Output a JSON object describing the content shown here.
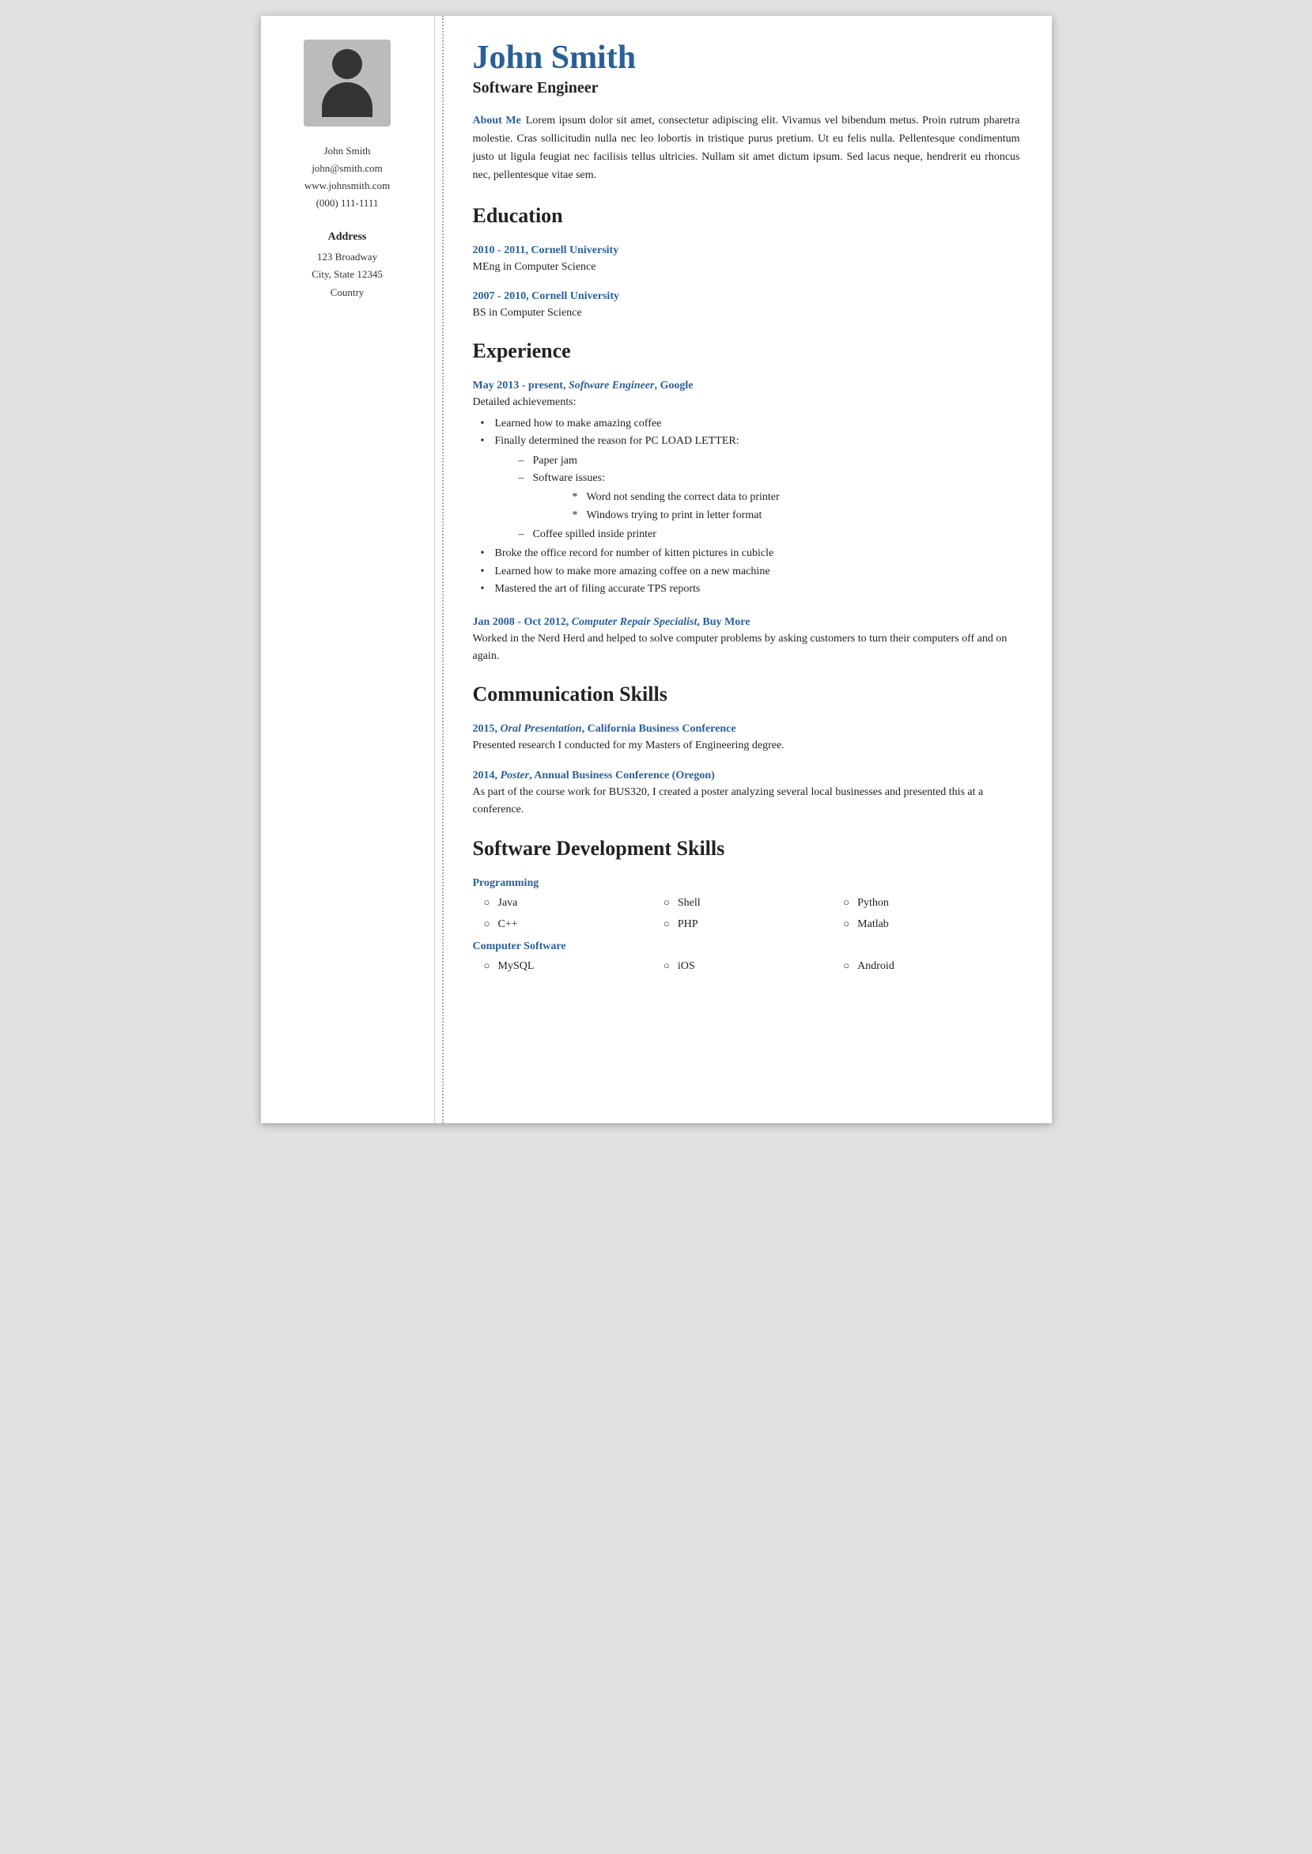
{
  "sidebar": {
    "name": "John Smith",
    "email": "john@smith.com",
    "website": "www.johnsmith.com",
    "phone": "(000) 111-1111",
    "address_label": "Address",
    "address_line1": "123 Broadway",
    "address_line2": "City, State 12345",
    "address_line3": "Country"
  },
  "main": {
    "name": "John Smith",
    "title": "Software Engineer",
    "about_me_label": "About Me",
    "about_me_text": "Lorem ipsum dolor sit amet, consectetur adipiscing elit. Vivamus vel bibendum metus. Proin rutrum pharetra molestie. Cras sollicitudin nulla nec leo lobortis in tristique purus pretium. Ut eu felis nulla. Pellentesque condimentum justo ut ligula feugiat nec facilisis tellus ultricies. Nullam sit amet dictum ipsum. Sed lacus neque, hendrerit eu rhoncus nec, pellentesque vitae sem.",
    "education_title": "Education",
    "education_entries": [
      {
        "header": "2010 - 2011, Cornell University",
        "body": "MEng in Computer Science"
      },
      {
        "header": "2007 - 2010, Cornell University",
        "body": "BS in Computer Science"
      }
    ],
    "experience_title": "Experience",
    "experience_entries": [
      {
        "header": "May 2013 - present, Software Engineer, Google",
        "achievements_label": "Detailed achievements:",
        "bullets": [
          "Learned how to make amazing coffee",
          "Finally determined the reason for PC LOAD LETTER:"
        ],
        "sub_dashes": [
          "Paper jam",
          "Software issues:"
        ],
        "sub_stars": [
          "Word not sending the correct data to printer",
          "Windows trying to print in letter format"
        ],
        "extra_dash": "Coffee spilled inside printer",
        "extra_bullets": [
          "Broke the office record for number of kitten pictures in cubicle",
          "Learned how to make more amazing coffee on a new machine",
          "Mastered the art of filing accurate TPS reports"
        ]
      },
      {
        "header": "Jan 2008 - Oct 2012, Computer Repair Specialist, Buy More",
        "body": "Worked in the Nerd Herd and helped to solve computer problems by asking customers to turn their computers off and on again."
      }
    ],
    "communication_title": "Communication Skills",
    "communication_entries": [
      {
        "header": "2015, Oral Presentation, California Business Conference",
        "body": "Presented research I conducted for my Masters of Engineering degree."
      },
      {
        "header": "2014, Poster, Annual Business Conference (Oregon)",
        "body": "As part of the course work for BUS320, I created a poster analyzing several local businesses and presented this at a conference."
      }
    ],
    "skills_title": "Software Development Skills",
    "skills_sections": [
      {
        "label": "Programming",
        "items": [
          "Java",
          "Shell",
          "Python",
          "C++",
          "PHP",
          "Matlab"
        ]
      },
      {
        "label": "Computer Software",
        "items": [
          "MySQL",
          "iOS",
          "Android"
        ]
      }
    ]
  }
}
